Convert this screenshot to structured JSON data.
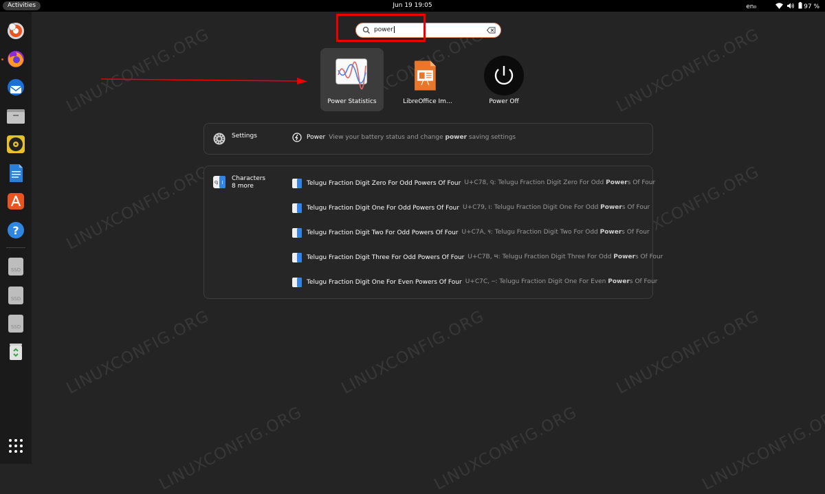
{
  "topbar": {
    "activities": "Activities",
    "clock": "Jun 19  19:05",
    "language": "en₀",
    "battery": "97 %"
  },
  "dock": {
    "items": [
      {
        "name": "ubuntu-disk-icon"
      },
      {
        "name": "firefox-icon"
      },
      {
        "name": "thunderbird-icon"
      },
      {
        "name": "files-icon"
      },
      {
        "name": "rhythmbox-icon"
      },
      {
        "name": "libreoffice-writer-icon"
      },
      {
        "name": "app-center-icon"
      },
      {
        "name": "help-icon"
      },
      {
        "name": "ssd-drive-icon",
        "label": "SSD"
      },
      {
        "name": "ssd-drive-icon",
        "label": "SSD"
      },
      {
        "name": "ssd-drive-icon",
        "label": "SSD"
      },
      {
        "name": "trash-icon"
      }
    ],
    "show_apps": "show-apps-grid-icon"
  },
  "search": {
    "value": "power"
  },
  "apps": [
    {
      "label": "Power Statistics",
      "selected": true,
      "icon": "power-statistics-icon"
    },
    {
      "label": "LibreOffice Im…",
      "selected": false,
      "icon": "libreoffice-impress-icon"
    },
    {
      "label": "Power Off",
      "selected": false,
      "icon": "power-off-icon"
    }
  ],
  "settings_provider": {
    "label": "Settings",
    "result": {
      "title": "Power",
      "desc_pre": "View your battery status and change ",
      "desc_bold": "power",
      "desc_post": " saving settings"
    }
  },
  "characters_provider": {
    "label": "Characters",
    "more": "8 more",
    "results": [
      {
        "title": "Telugu Fraction Digit Zero For Odd Powers Of Four",
        "desc_pre": "U+C78, ౸: Telugu Fraction Digit Zero For Odd ",
        "desc_bold": "Power",
        "desc_post": "s Of Four"
      },
      {
        "title": "Telugu Fraction Digit One For Odd Powers Of Four",
        "desc_pre": "U+C79, ౹: Telugu Fraction Digit One For Odd ",
        "desc_bold": "Power",
        "desc_post": "s Of Four"
      },
      {
        "title": "Telugu Fraction Digit Two For Odd Powers Of Four",
        "desc_pre": "U+C7A, ౺: Telugu Fraction Digit Two For Odd ",
        "desc_bold": "Power",
        "desc_post": "s Of Four"
      },
      {
        "title": "Telugu Fraction Digit Three For Odd Powers Of Four",
        "desc_pre": "U+C7B, ౻: Telugu Fraction Digit Three For Odd ",
        "desc_bold": "Power",
        "desc_post": "s Of Four"
      },
      {
        "title": "Telugu Fraction Digit One For Even Powers Of Four",
        "desc_pre": "U+C7C, ౼: Telugu Fraction Digit One For Even ",
        "desc_bold": "Power",
        "desc_post": "s Of Four"
      }
    ]
  },
  "watermark": "LINUXCONFIG.ORG",
  "colors": {
    "accent": "#e95420",
    "highlight_box": "#e00000",
    "background": "#242424"
  }
}
